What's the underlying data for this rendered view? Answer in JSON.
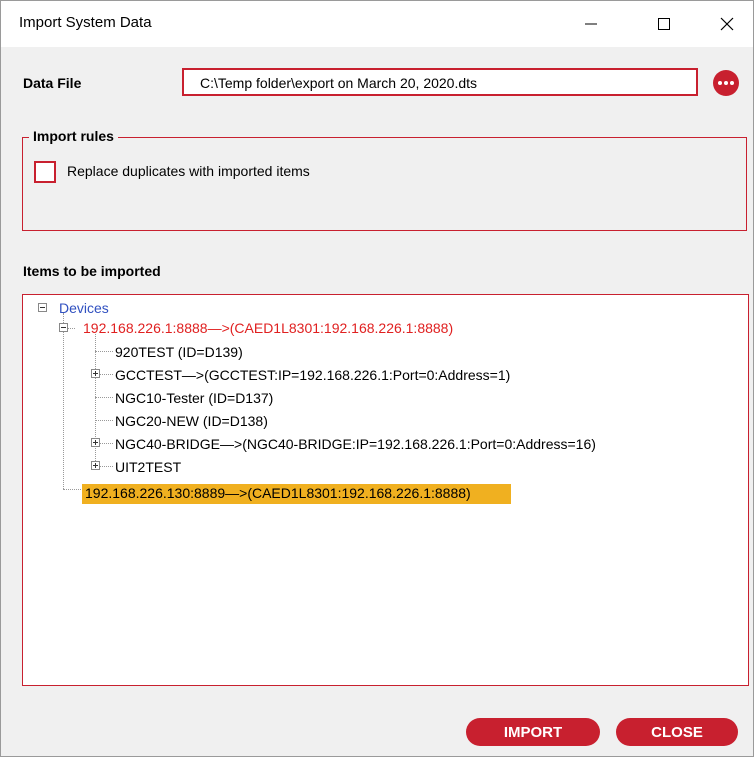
{
  "window": {
    "title": "Import System Data",
    "controls": {
      "minimize_icon": "—",
      "maximize_icon": "☐",
      "close_icon": "✕"
    }
  },
  "data_file": {
    "label": "Data File",
    "value": "C:\\Temp folder\\export on March 20, 2020.dts"
  },
  "import_rules": {
    "legend": "Import rules",
    "replace_duplicates_label": "Replace duplicates with imported items",
    "replace_duplicates_checked": false
  },
  "items": {
    "heading": "Items  to be imported",
    "tree": {
      "root": "Devices",
      "node1": "192.168.226.1:8888—>(CAED1L8301:192.168.226.1:8888)",
      "children": [
        "920TEST (ID=D139)",
        "GCCTEST—>(GCCTEST:IP=192.168.226.1:Port=0:Address=1)",
        "NGC10-Tester (ID=D137)",
        "NGC20-NEW (ID=D138)",
        "NGC40-BRIDGE—>(NGC40-BRIDGE:IP=192.168.226.1:Port=0:Address=16)",
        "UIT2TEST"
      ],
      "node2": "192.168.226.130:8889—>(CAED1L8301:192.168.226.1:8888)"
    }
  },
  "buttons": {
    "import": "IMPORT",
    "close": "CLOSE"
  },
  "colors": {
    "accent": "#c8202f",
    "highlight": "#f0b020",
    "root_text": "#3050c0"
  }
}
